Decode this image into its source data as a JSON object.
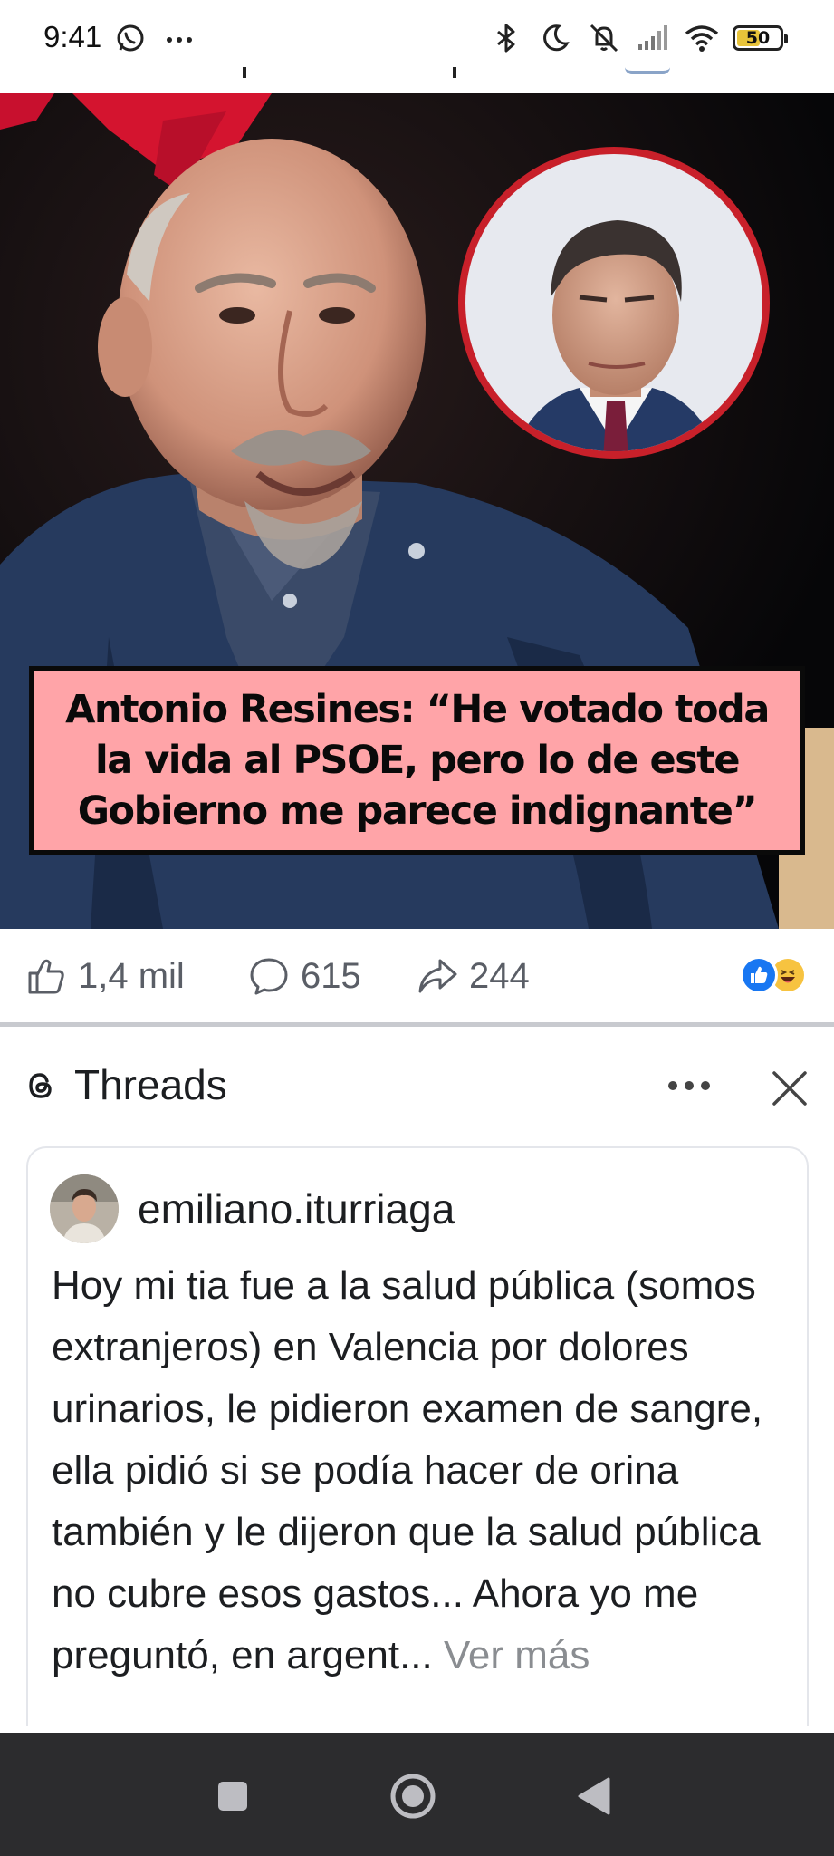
{
  "status_bar": {
    "time": "9:41",
    "battery": "50",
    "icons": [
      "whatsapp-icon",
      "more-notifications-icon",
      "bluetooth-icon",
      "dnd-moon-icon",
      "mute-icon",
      "signal-icon",
      "wifi-icon",
      "battery-icon"
    ]
  },
  "post": {
    "headline_lines": [
      "Antonio Resines: “He votado toda",
      "la vida al PSOE, pero lo de este",
      "Gobierno me parece indignante”"
    ],
    "likes": "1,4 mil",
    "comments": "615",
    "shares": "244",
    "reaction_icons": [
      "like-reaction-icon",
      "haha-reaction-icon"
    ]
  },
  "threads": {
    "title": "Threads",
    "username": "emiliano.iturriaga",
    "text": "Hoy mi tia fue a la salud pública (somos extranjeros) en Valencia por dolores urinarios, le pidieron examen de sangre, ella pidió si se podía hacer de orina también y le dijeron que la salud pública no cubre esos gastos... Ahora yo me preguntó, en argent...",
    "see_more": " Ver más"
  },
  "colors": {
    "headline_bg": "#ffa4a8",
    "reaction_text": "#5a5e66",
    "see_more": "#8a8d91",
    "nav_bar": "#2c2c2e",
    "like_blue": "#1877f2"
  }
}
